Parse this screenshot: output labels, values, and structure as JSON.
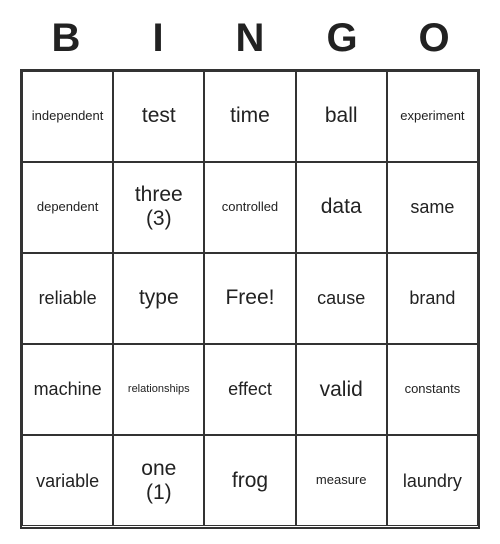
{
  "header": [
    "B",
    "I",
    "N",
    "G",
    "O"
  ],
  "grid": [
    [
      {
        "text": "independent",
        "size": "small"
      },
      {
        "text": "test",
        "size": "normal"
      },
      {
        "text": "time",
        "size": "normal"
      },
      {
        "text": "ball",
        "size": "normal"
      },
      {
        "text": "experiment",
        "size": "small"
      }
    ],
    [
      {
        "text": "dependent",
        "size": "small"
      },
      {
        "text": "three\n(3)",
        "size": "normal"
      },
      {
        "text": "controlled",
        "size": "small"
      },
      {
        "text": "data",
        "size": "normal"
      },
      {
        "text": "same",
        "size": "medium"
      }
    ],
    [
      {
        "text": "reliable",
        "size": "medium"
      },
      {
        "text": "type",
        "size": "normal"
      },
      {
        "text": "Free!",
        "size": "normal"
      },
      {
        "text": "cause",
        "size": "medium"
      },
      {
        "text": "brand",
        "size": "medium"
      }
    ],
    [
      {
        "text": "machine",
        "size": "medium"
      },
      {
        "text": "relationships",
        "size": "xsmall"
      },
      {
        "text": "effect",
        "size": "medium"
      },
      {
        "text": "valid",
        "size": "normal"
      },
      {
        "text": "constants",
        "size": "small"
      }
    ],
    [
      {
        "text": "variable",
        "size": "medium"
      },
      {
        "text": "one\n(1)",
        "size": "normal"
      },
      {
        "text": "frog",
        "size": "normal"
      },
      {
        "text": "measure",
        "size": "small"
      },
      {
        "text": "laundry",
        "size": "medium"
      }
    ]
  ]
}
